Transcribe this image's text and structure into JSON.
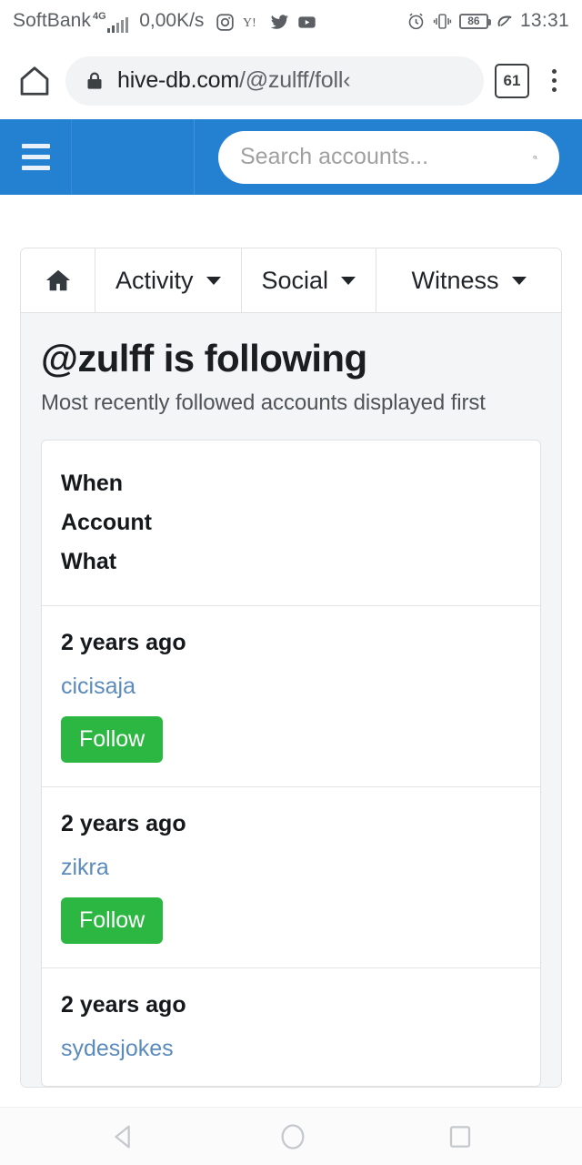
{
  "status_bar": {
    "carrier": "SoftBank",
    "network": "4G",
    "data_speed": "0,00K/s",
    "notification_icons": [
      "instagram-icon",
      "yahoo-icon",
      "twitter-icon",
      "youtube-icon"
    ],
    "system_icons": [
      "alarm-icon",
      "vibrate-icon",
      "battery-icon",
      "power-saving-leaf-icon"
    ],
    "battery_level": "86",
    "time": "13:31"
  },
  "browser": {
    "home_icon": "home-icon",
    "lock_icon": "lock-icon",
    "url_domain": "hive-db.com",
    "url_path": "/@zulff/foll‹",
    "tab_count": "61",
    "menu_icon": "kebab-menu-icon"
  },
  "site_header": {
    "menu_icon": "hamburger-icon",
    "search_placeholder": "Search accounts...",
    "search_value": "",
    "search_icon": "search-icon",
    "background_color": "#2480d1"
  },
  "nav_tabs": [
    {
      "label": "",
      "icon": "home-icon",
      "has_caret": false
    },
    {
      "label": "Activity",
      "icon": "",
      "has_caret": true
    },
    {
      "label": "Social",
      "icon": "",
      "has_caret": true
    },
    {
      "label": "Witness",
      "icon": "",
      "has_caret": true
    }
  ],
  "main": {
    "title": "@zulff is following",
    "subtitle": "Most recently followed accounts displayed first",
    "table_headers": {
      "when": "When",
      "account": "Account",
      "what": "What"
    },
    "rows": [
      {
        "when": "2 years ago",
        "account": "cicisaja",
        "action": "Follow"
      },
      {
        "when": "2 years ago",
        "account": "zikra",
        "action": "Follow"
      },
      {
        "when": "2 years ago",
        "account": "sydesjokes",
        "action": ""
      }
    ]
  },
  "colors": {
    "accent_blue": "#2480d1",
    "follow_green": "#2cb742",
    "link_blue": "#5b8bbd",
    "panel_bg": "#f4f5f6"
  },
  "android_nav": {
    "back": "back-triangle-icon",
    "home": "home-circle-icon",
    "recents": "recents-square-icon"
  }
}
